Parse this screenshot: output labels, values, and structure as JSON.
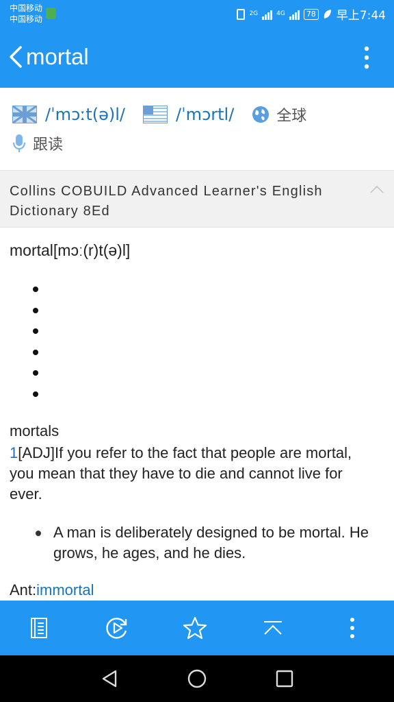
{
  "status_bar": {
    "carrier1": "中国移动",
    "carrier2": "中国移动",
    "net1": "2G",
    "net2": "4G",
    "battery": "78",
    "time": "早上7:44"
  },
  "app_bar": {
    "title": "mortal",
    "back_icon": "chevron-left-icon",
    "menu_icon": "more-vertical-icon"
  },
  "pronunciation": {
    "uk_ipa": "/ˈmɔːt(ə)l/",
    "us_ipa": "/ˈmɔrtl/",
    "global_label": "全球",
    "follow_label": "跟读"
  },
  "dictionary": {
    "name": "Collins COBUILD Advanced Learner's English Dictionary 8Ed"
  },
  "entry": {
    "headword": "mortal[mɔː(r)t(ə)l]",
    "bullet_count": 6,
    "inflection": "mortals",
    "sense_number": "1",
    "definition": "[ADJ]If you refer to the fact that people are mortal, you mean that they have to die and cannot live for ever.",
    "example": "A man is deliberately designed to be mortal. He grows, he ages, and he dies.",
    "antonym_label": "Ant:",
    "antonym_link": "immortal"
  },
  "toolbar": {
    "icons": [
      "notebook-icon",
      "replay-icon",
      "star-icon",
      "scroll-top-icon",
      "more-vertical-icon"
    ]
  },
  "colors": {
    "primary": "#2196f3",
    "link": "#1a73b8",
    "header_bg": "#f1f1f1"
  }
}
